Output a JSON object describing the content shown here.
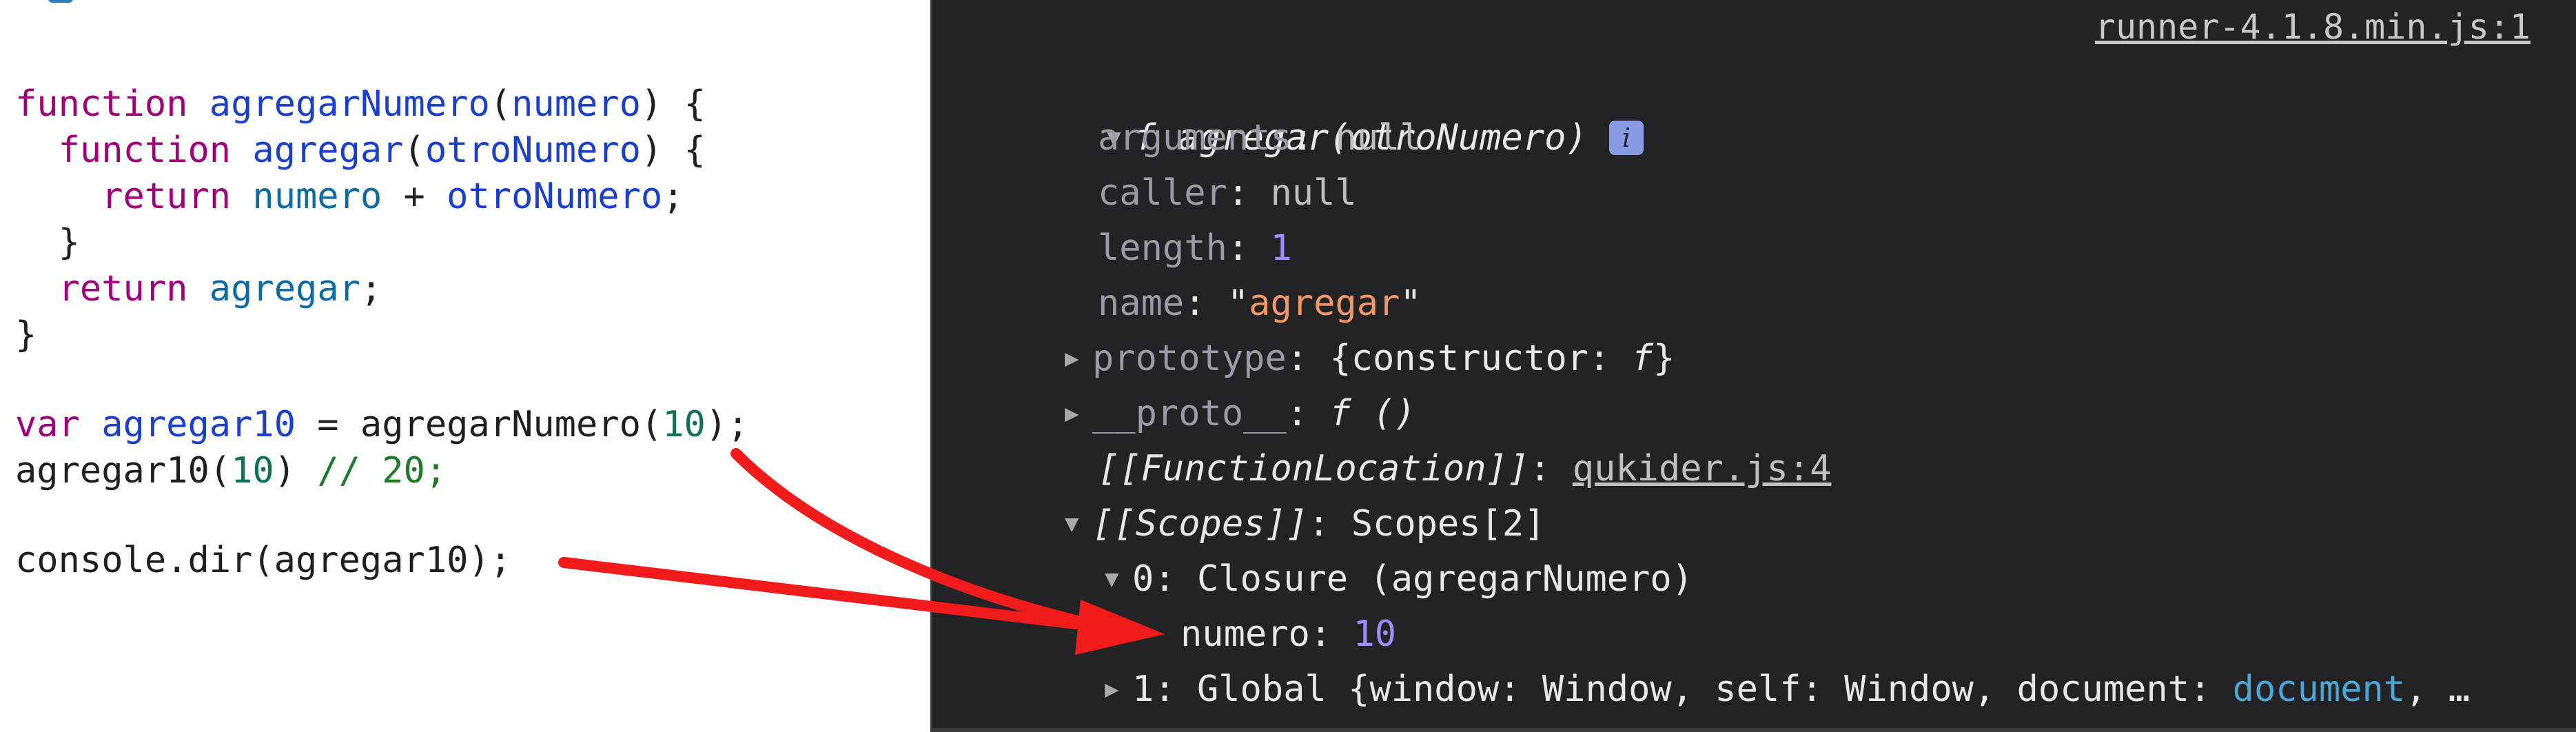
{
  "editor": {
    "line_fn1": {
      "kw": "function",
      "name": "agregarNumero",
      "open": "(",
      "param": "numero",
      "close": ") {"
    },
    "line_fn2": {
      "kw": "function",
      "name": "agregar",
      "open": "(",
      "param": "otroNumero",
      "close": ") {"
    },
    "line_ret1": {
      "kw": "return",
      "a": "numero",
      "op": " + ",
      "b": "otroNumero",
      "end": ";"
    },
    "line_brace1": "}",
    "line_ret2": {
      "kw": "return",
      "id": "agregar",
      "end": ";"
    },
    "line_brace2": "}",
    "line_var": {
      "kw": "var",
      "id": "agregar10",
      "mid": " = agregarNumero(",
      "num": "10",
      "end": ");"
    },
    "line_call": {
      "fn": "agregar10(",
      "num": "10",
      "close": ")",
      "comment": " // 20;"
    },
    "line_dir": "console.dir(agregar10);"
  },
  "console": {
    "source_link": "runner-4.1.8.min.js:1",
    "header": {
      "f": "f",
      "signature": "agregar(otroNumero)",
      "info_icon_glyph": "i"
    },
    "props": [
      {
        "key": "arguments",
        "sep": ": ",
        "value": "null"
      },
      {
        "key": "caller",
        "sep": ": ",
        "value": "null"
      },
      {
        "key": "length",
        "sep": ": ",
        "value": "1"
      },
      {
        "key": "name",
        "sep": ": ",
        "quote_open": "\"",
        "value": "agregar",
        "quote_close": "\""
      }
    ],
    "prototype": {
      "key": "prototype",
      "sep": ": ",
      "value_a": "{constructor: ",
      "f": "f",
      "value_b": "}"
    },
    "proto": {
      "key": "__proto__",
      "sep": ": ",
      "value": "f ()"
    },
    "function_location": {
      "key": "[[FunctionLocation]]",
      "sep": ": ",
      "link": "qukider.js:4"
    },
    "scopes": {
      "key": "[[Scopes]]",
      "sep": ": ",
      "value": "Scopes[2]"
    },
    "closure": {
      "key": "0",
      "sep": ": ",
      "value": "Closure (agregarNumero)"
    },
    "numero": {
      "key": "numero",
      "sep": ": ",
      "value": "10"
    },
    "global": {
      "key": "1",
      "sep": ": ",
      "value_a": "Global {window: Window, self: Window, document: ",
      "doc": "document",
      "value_b": ", …"
    }
  },
  "colors": {
    "arrow": "#f21b1b",
    "console_bg": "#232325",
    "keyword": "#a0007a",
    "function_name": "#1a3fd0",
    "number_console": "#a08cff",
    "string_console": "#f29766"
  }
}
